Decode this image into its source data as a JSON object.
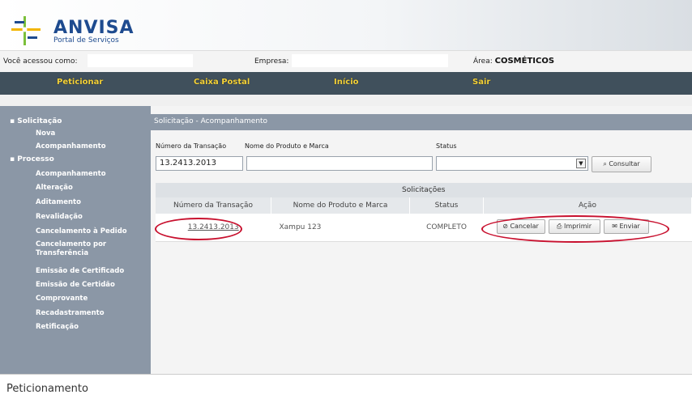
{
  "brand": {
    "title": "ANVISA",
    "subtitle": "Portal de Serviços"
  },
  "userbar": {
    "user_label": "Você acessou como:",
    "company_label": "Empresa:",
    "area_label": "Área:",
    "area_value": "COSMÉTICOS"
  },
  "nav": {
    "items": [
      "Peticionar",
      "Caixa Postal",
      "Início",
      "Sair"
    ]
  },
  "sidebar": {
    "sections": [
      {
        "label": "Solicitação",
        "items": [
          "Nova",
          "Acompanhamento"
        ]
      },
      {
        "label": "Processo",
        "items": [
          "Acompanhamento",
          "Alteração",
          "Aditamento",
          "Revalidação",
          "Cancelamento à Pedido",
          "Cancelamento por Transferência",
          "Emissão de Certificado",
          "Emissão de Certidão",
          "Comprovante",
          "Recadastramento",
          "Retificação"
        ]
      }
    ]
  },
  "panel": {
    "title": "Solicitação - Acompanhamento"
  },
  "filters": {
    "transaction_label": "Número da Transação",
    "transaction_value": "13.2413.2013",
    "product_label": "Nome do Produto e Marca",
    "product_value": "",
    "status_label": "Status",
    "status_value": "",
    "search_label": "Consultar"
  },
  "table": {
    "caption": "Solicitações",
    "headers": [
      "Número da Transação",
      "Nome do Produto e Marca",
      "Status",
      "Ação"
    ],
    "rows": [
      {
        "transaction": "13.2413.2013",
        "product": "Xampu 123",
        "status": "COMPLETO"
      }
    ],
    "actions": [
      "Cancelar",
      "Imprimir",
      "Enviar"
    ]
  },
  "footer": {
    "text": "Peticionamento"
  },
  "colors": {
    "nav_bg": "#40505c",
    "nav_text": "#f5d33a",
    "sidebar_bg": "#8b97a6",
    "highlight": "#c8102e",
    "brand": "#1e4b8f"
  }
}
